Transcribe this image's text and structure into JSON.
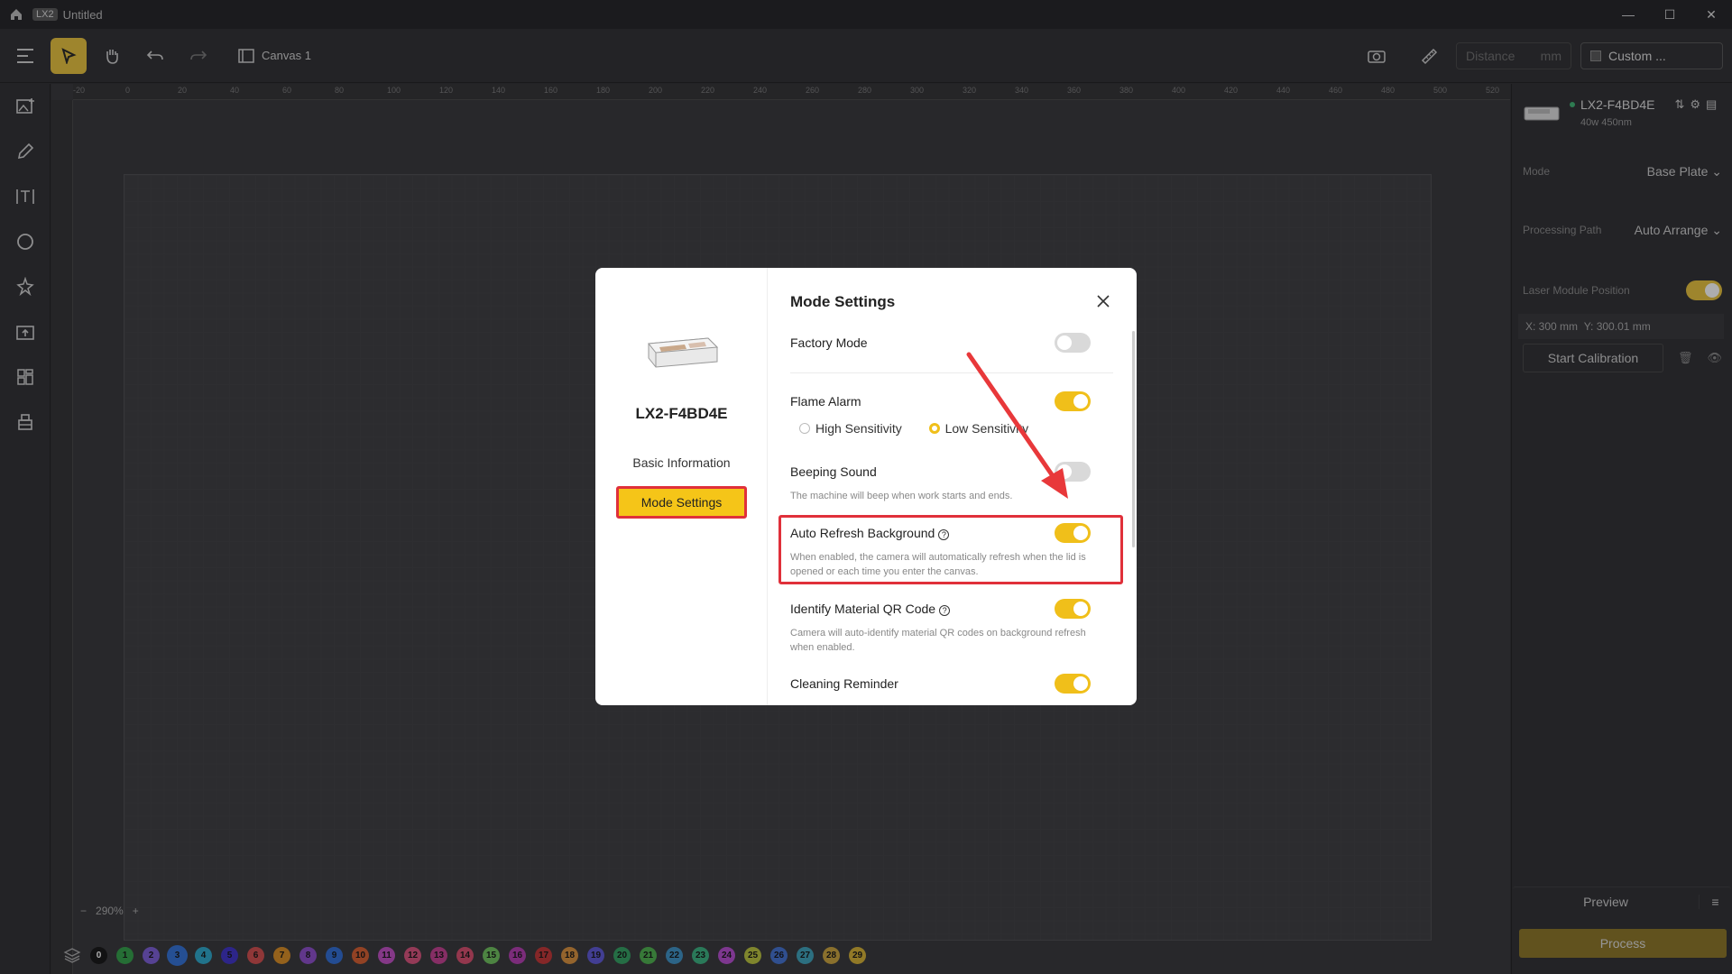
{
  "titlebar": {
    "app_badge": "LX2",
    "doc_title": "Untitled"
  },
  "toolbar": {
    "canvas_label": "Canvas 1",
    "distance_placeholder": "Distance",
    "distance_unit": "mm",
    "custom_label": "Custom ..."
  },
  "ruler": {
    "ticks": [
      "-20",
      "0",
      "20",
      "40",
      "60",
      "80",
      "100",
      "120",
      "140",
      "160",
      "180",
      "200",
      "220",
      "240",
      "260",
      "280",
      "300",
      "320",
      "340",
      "360",
      "380",
      "400",
      "420",
      "440",
      "460",
      "480",
      "500",
      "520"
    ]
  },
  "zoom": {
    "minus": "−",
    "value": "290%",
    "plus": "+"
  },
  "layers": [
    {
      "n": "0",
      "c": "#111111",
      "t": "#ffffff"
    },
    {
      "n": "1",
      "c": "#2e9e45"
    },
    {
      "n": "2",
      "c": "#7a5bd6"
    },
    {
      "n": "3",
      "c": "#2f6fd6"
    },
    {
      "n": "4",
      "c": "#28a6c9"
    },
    {
      "n": "5",
      "c": "#3b2fc7"
    },
    {
      "n": "6",
      "c": "#d24a4a"
    },
    {
      "n": "7",
      "c": "#d98a1f"
    },
    {
      "n": "8",
      "c": "#8a4bc9"
    },
    {
      "n": "9",
      "c": "#2c6bd4"
    },
    {
      "n": "10",
      "c": "#d65b2c"
    },
    {
      "n": "11",
      "c": "#c14cc4"
    },
    {
      "n": "12",
      "c": "#d94f7a"
    },
    {
      "n": "13",
      "c": "#c43c8f"
    },
    {
      "n": "14",
      "c": "#d84b6b"
    },
    {
      "n": "15",
      "c": "#6cc05a"
    },
    {
      "n": "16",
      "c": "#b33ab0"
    },
    {
      "n": "17",
      "c": "#c23232"
    },
    {
      "n": "18",
      "c": "#d9903a"
    },
    {
      "n": "19",
      "c": "#5b55d6"
    },
    {
      "n": "20",
      "c": "#2f9e5e"
    },
    {
      "n": "21",
      "c": "#4ab04a"
    },
    {
      "n": "22",
      "c": "#3a8fc4"
    },
    {
      "n": "23",
      "c": "#36b07d"
    },
    {
      "n": "24",
      "c": "#b54bd0"
    },
    {
      "n": "25",
      "c": "#b8c23a"
    },
    {
      "n": "26",
      "c": "#3f6fd0"
    },
    {
      "n": "27",
      "c": "#3aa0b8"
    },
    {
      "n": "28",
      "c": "#c9a23a"
    },
    {
      "n": "29",
      "c": "#d4b030"
    }
  ],
  "rpanel": {
    "device_name": "LX2-F4BD4E",
    "device_spec": "40w 450nm",
    "mode_label": "Mode",
    "mode_value": "Base Plate",
    "path_label": "Processing Path",
    "path_value": "Auto Arrange",
    "laser_pos_label": "Laser Module Position",
    "coord_x": "X: 300 mm",
    "coord_y": "Y: 300.01 mm",
    "calib_button": "Start Calibration",
    "preview_button": "Preview",
    "process_button": "Process"
  },
  "modal": {
    "device_name": "LX2-F4BD4E",
    "nav_basic": "Basic Information",
    "nav_mode": "Mode Settings",
    "title": "Mode Settings",
    "factory_mode": "Factory Mode",
    "flame_alarm": "Flame Alarm",
    "high_sens": "High Sensitivity",
    "low_sens": "Low Sensitivity",
    "beeping": "Beeping Sound",
    "beeping_desc": "The machine will beep when work starts and ends.",
    "auto_refresh": "Auto Refresh Background",
    "auto_refresh_desc": "When enabled, the camera will automatically refresh when the lid is opened or each time you enter the canvas.",
    "identify_qr": "Identify Material QR Code",
    "identify_qr_desc": "Camera will auto-identify material QR codes on background refresh when enabled.",
    "cleaning": "Cleaning Reminder"
  },
  "colors": {
    "accent": "#f0bf1a",
    "highlight": "#e0303a"
  }
}
